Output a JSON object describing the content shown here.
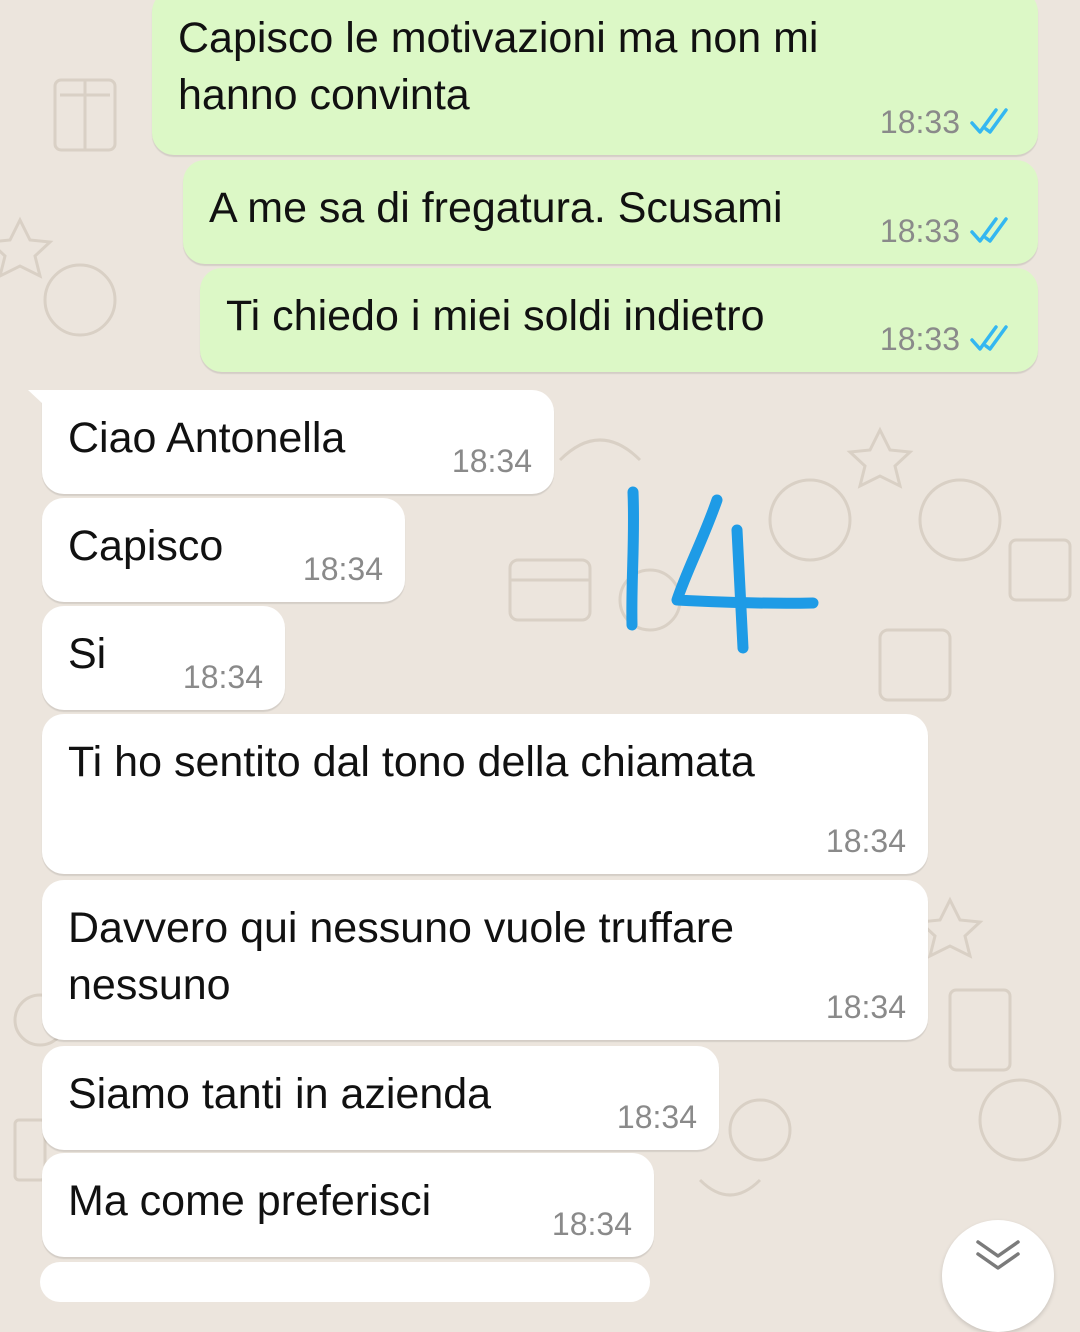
{
  "messages": [
    {
      "direction": "outgoing",
      "text": "Capisco le motivazioni ma non mi hanno convinta",
      "time": "18:33",
      "status": "read"
    },
    {
      "direction": "outgoing",
      "text": "A me sa di fregatura. Scusami",
      "time": "18:33",
      "status": "read"
    },
    {
      "direction": "outgoing",
      "text": "Ti chiedo i miei soldi indietro",
      "time": "18:33",
      "status": "read"
    },
    {
      "direction": "incoming",
      "text": "Ciao Antonella",
      "time": "18:34"
    },
    {
      "direction": "incoming",
      "text": "Capisco",
      "time": "18:34"
    },
    {
      "direction": "incoming",
      "text": "Si",
      "time": "18:34"
    },
    {
      "direction": "incoming",
      "text": "Ti ho sentito dal tono della chiamata",
      "time": "18:34"
    },
    {
      "direction": "incoming",
      "text": "Davvero qui nessuno vuole truffare nessuno",
      "time": "18:34"
    },
    {
      "direction": "incoming",
      "text": "Siamo tanti in azienda",
      "time": "18:34"
    },
    {
      "direction": "incoming",
      "text": "Ma come preferisci",
      "time": "18:34"
    }
  ],
  "annotation": "14",
  "colors": {
    "background": "#ece5dd",
    "outgoing_bubble": "#dcf8c6",
    "incoming_bubble": "#ffffff",
    "read_ticks": "#34b7f1",
    "annotation_ink": "#1e9be6"
  },
  "icons": {
    "read_receipt": "double-check-icon",
    "scroll_down": "chevron-double-down-icon"
  }
}
